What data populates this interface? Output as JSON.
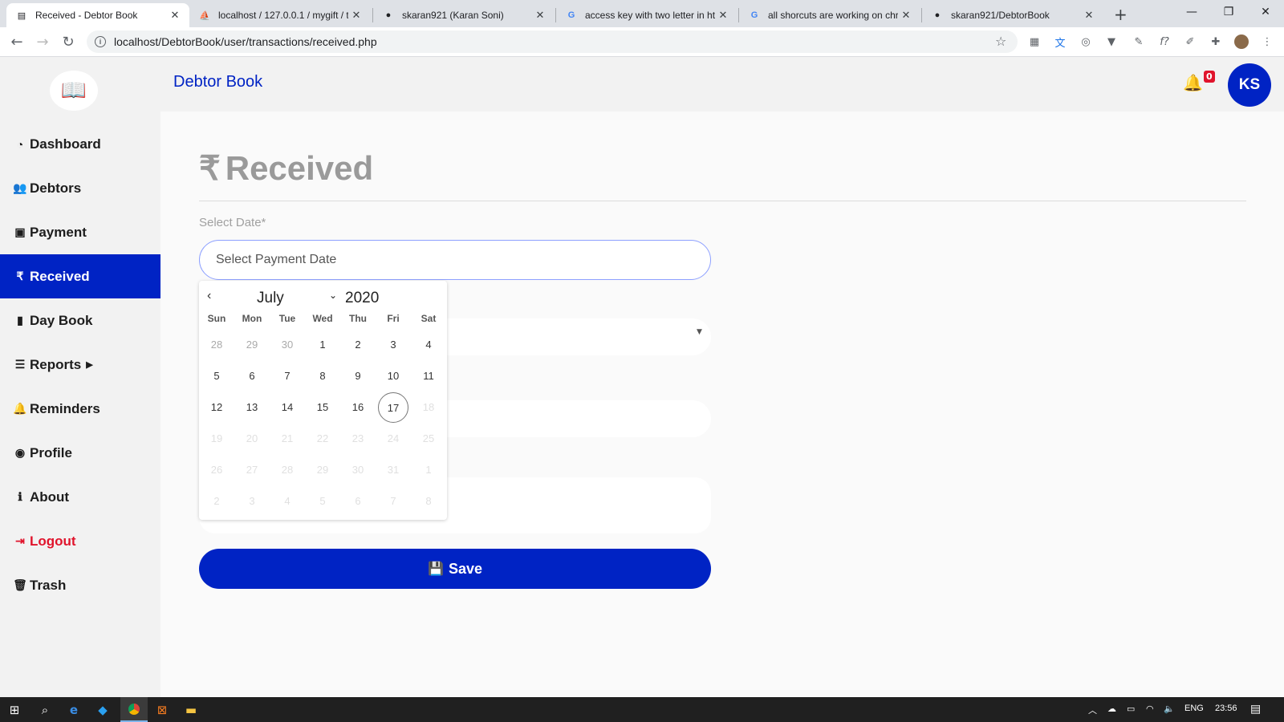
{
  "browser": {
    "tabs": [
      {
        "title": "Received - Debtor Book",
        "icon": "document-icon",
        "active": true
      },
      {
        "title": "localhost / 127.0.0.1 / mygift / t",
        "icon": "phpmyadmin-icon",
        "active": false
      },
      {
        "title": "skaran921 (Karan Soni)",
        "icon": "github-icon",
        "active": false
      },
      {
        "title": "access key with two letter in ht",
        "icon": "google-icon",
        "active": false
      },
      {
        "title": "all shorcuts are working on chr",
        "icon": "google-icon",
        "active": false
      },
      {
        "title": "skaran921/DebtorBook",
        "icon": "github-icon",
        "active": false
      }
    ],
    "url": "localhost/DebtorBook/user/transactions/received.php"
  },
  "app": {
    "brand": "Debtor Book",
    "notification_count": "0",
    "avatar_initials": "KS",
    "accent_color": "#0023c4"
  },
  "sidebar": {
    "items": [
      {
        "label": "Dashboard",
        "icon": "tachometer-icon"
      },
      {
        "label": "Debtors",
        "icon": "users-icon"
      },
      {
        "label": "Payment",
        "icon": "money-bill-icon"
      },
      {
        "label": "Received",
        "icon": "rupee-icon",
        "active": true
      },
      {
        "label": "Day Book",
        "icon": "book-icon"
      },
      {
        "label": "Reports",
        "icon": "list-icon",
        "has_submenu": true
      },
      {
        "label": "Reminders",
        "icon": "bell-icon"
      },
      {
        "label": "Profile",
        "icon": "user-circle-icon"
      },
      {
        "label": "About",
        "icon": "info-circle-icon"
      },
      {
        "label": "Logout",
        "icon": "sign-out-icon"
      },
      {
        "label": "Trash",
        "icon": "trash-icon"
      }
    ]
  },
  "page": {
    "title": "Received",
    "date_label": "Select Date*",
    "date_placeholder": "Select Payment Date",
    "save_label": "Save"
  },
  "calendar": {
    "month": "July",
    "year": "2020",
    "weekdays": [
      "Sun",
      "Mon",
      "Tue",
      "Wed",
      "Thu",
      "Fri",
      "Sat"
    ],
    "weeks": [
      [
        "28",
        "29",
        "30",
        "1",
        "2",
        "3",
        "4"
      ],
      [
        "5",
        "6",
        "7",
        "8",
        "9",
        "10",
        "11"
      ],
      [
        "12",
        "13",
        "14",
        "15",
        "16",
        "17",
        "18"
      ],
      [
        "19",
        "20",
        "21",
        "22",
        "23",
        "24",
        "25"
      ],
      [
        "26",
        "27",
        "28",
        "29",
        "30",
        "31",
        "1"
      ],
      [
        "2",
        "3",
        "4",
        "5",
        "6",
        "7",
        "8"
      ]
    ],
    "today": "17"
  },
  "taskbar": {
    "language": "ENG",
    "time": "23:56"
  }
}
